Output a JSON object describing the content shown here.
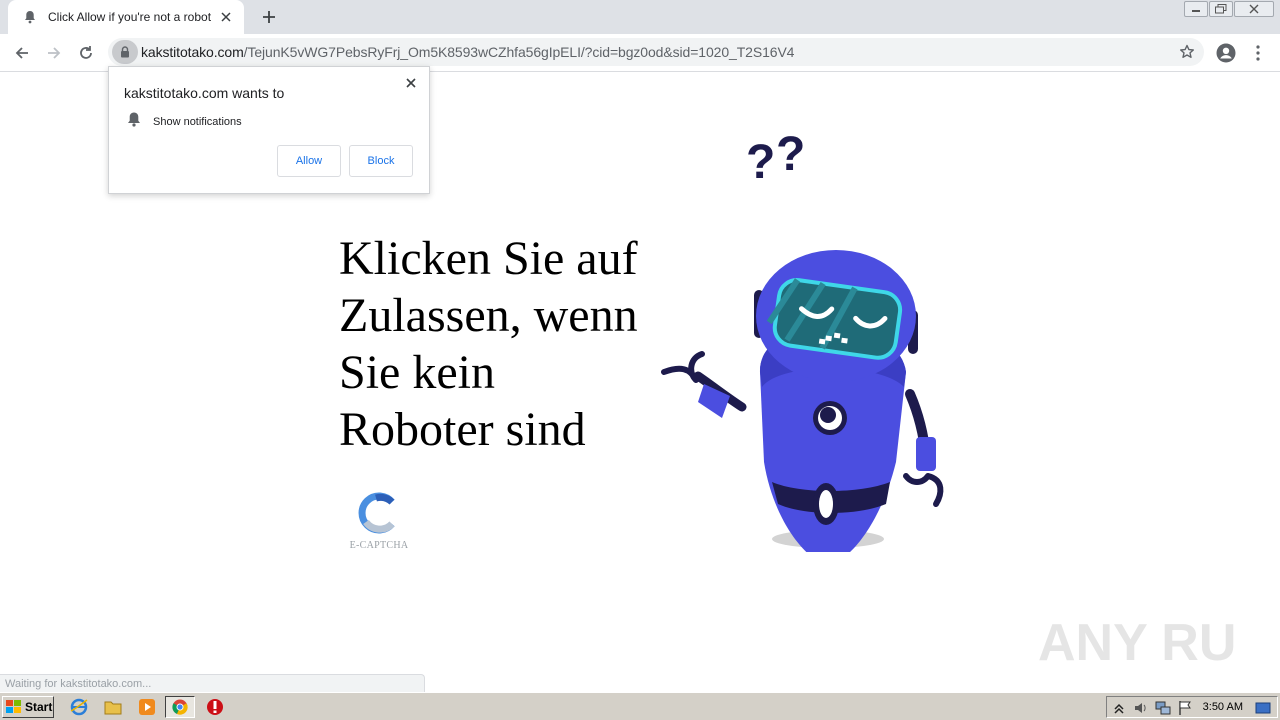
{
  "browser": {
    "tab_title": "Click Allow if you're not a robot",
    "url_domain": "kakstitotako.com",
    "url_path": "/TejunK5vWG7PebsRyFrj_Om5K8593wCZhfa56gIpELI/?cid=bgz0od&sid=1020_T2S16V4"
  },
  "popup": {
    "title": "kakstitotako.com wants to",
    "permission_label": "Show notifications",
    "allow_label": "Allow",
    "block_label": "Block"
  },
  "page": {
    "headline_lines": [
      "Klicken Sie auf",
      "Zulassen, wenn",
      "Sie kein",
      "Roboter sind"
    ],
    "captcha_label": "E-CAPTCHA",
    "status_text": "Waiting for kakstitotako.com..."
  },
  "watermark": {
    "text": "ANY RUN"
  },
  "taskbar": {
    "start_label": "Start",
    "clock": "3:50 AM"
  },
  "colors": {
    "robot_body": "#4b4ee0",
    "robot_dark": "#1d1b4c",
    "visor": "#1f6b78",
    "visor_rim": "#3fd7e8",
    "link_blue": "#1a73e8"
  },
  "icons": [
    "bell-icon",
    "close-icon",
    "plus-icon",
    "back-arrow-icon",
    "forward-arrow-icon",
    "reload-icon",
    "lock-icon",
    "star-icon",
    "account-icon",
    "kebab-menu-icon"
  ]
}
